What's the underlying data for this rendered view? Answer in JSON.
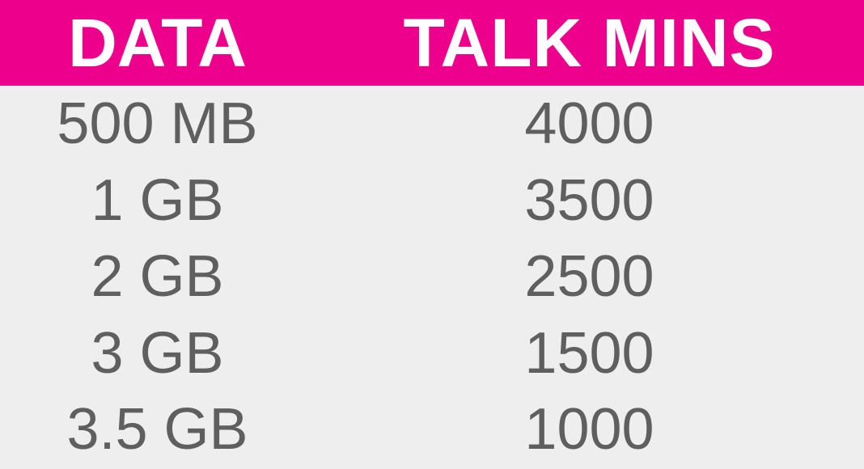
{
  "colors": {
    "header_bg": "#ec008c",
    "header_text": "#ffffff",
    "body_bg": "#eeeeee",
    "body_text": "#5f5f5f"
  },
  "table": {
    "headers": [
      "DATA",
      "TALK MINS"
    ],
    "rows": [
      [
        "500 MB",
        "4000"
      ],
      [
        "1 GB",
        "3500"
      ],
      [
        "2 GB",
        "2500"
      ],
      [
        "3 GB",
        "1500"
      ],
      [
        "3.5 GB",
        "1000"
      ]
    ]
  }
}
